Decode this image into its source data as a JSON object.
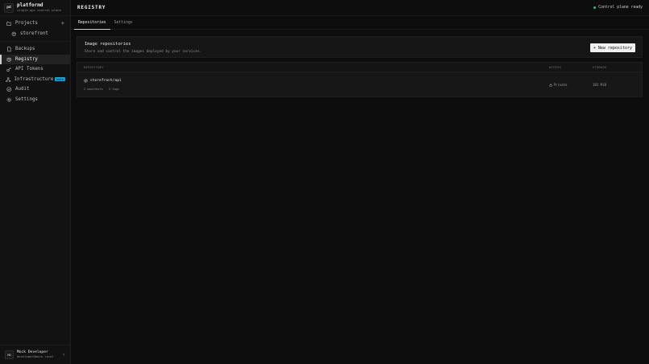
{
  "brand": {
    "logo": "pd",
    "name": "platformd",
    "subtitle": "single-ops control plane"
  },
  "sidebar": {
    "projects_label": "Projects",
    "projects": [
      {
        "label": "storefront",
        "icon": "package-icon"
      }
    ],
    "items": [
      {
        "label": "Backups",
        "icon": "file-icon"
      },
      {
        "label": "Registry",
        "icon": "box-icon",
        "active": true
      },
      {
        "label": "API Tokens",
        "icon": "key-icon"
      },
      {
        "label": "Infrastructure",
        "icon": "network-icon",
        "badge": "beta"
      },
      {
        "label": "Audit",
        "icon": "check-circle-icon"
      },
      {
        "label": "Settings",
        "icon": "gear-icon"
      }
    ]
  },
  "user": {
    "initials": "MD",
    "name": "Mock Developer",
    "email": "developer@mock.local"
  },
  "header": {
    "title": "REGISTRY",
    "status": "Control plane ready",
    "status_color": "#2ec27e"
  },
  "tabs": [
    {
      "label": "Repositories",
      "active": true
    },
    {
      "label": "Settings",
      "active": false
    }
  ],
  "panel": {
    "title": "Image repositories",
    "subtitle": "Store and control the images deployed by your services.",
    "new_button": "New repository"
  },
  "table": {
    "headers": {
      "repository": "REPOSITORY",
      "access": "ACCESS",
      "storage": "STORAGE"
    },
    "rows": [
      {
        "name": "storefront/api",
        "manifests": "2 manifests",
        "tags": "3 tags",
        "access": "Private",
        "storage": "183 MiB"
      }
    ]
  }
}
